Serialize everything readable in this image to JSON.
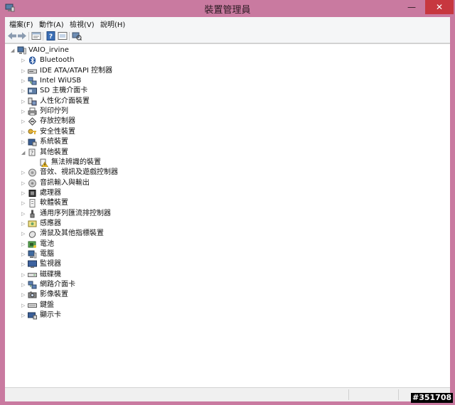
{
  "window": {
    "title": "裝置管理員",
    "minimize": "—",
    "maximize": "□",
    "close": "✕"
  },
  "menubar": {
    "items": [
      "檔案(F)",
      "動作(A)",
      "檢視(V)",
      "說明(H)"
    ]
  },
  "toolbar": {
    "buttons": [
      "back-icon",
      "forward-icon",
      "properties-icon",
      "help-icon",
      "update-view-icon",
      "scan-hardware-icon"
    ]
  },
  "tree": {
    "root": "VAIO_irvine",
    "categories": [
      {
        "label": "Bluetooth",
        "icon": "bluetooth-icon",
        "expanded": false
      },
      {
        "label": "IDE ATA/ATAPI 控制器",
        "icon": "ide-controller-icon",
        "expanded": false
      },
      {
        "label": "Intel WiUSB",
        "icon": "network-icon",
        "expanded": false
      },
      {
        "label": "SD 主機介面卡",
        "icon": "sd-host-icon",
        "expanded": false
      },
      {
        "label": "人性化介面裝置",
        "icon": "hid-icon",
        "expanded": false
      },
      {
        "label": "列印佇列",
        "icon": "printer-icon",
        "expanded": false
      },
      {
        "label": "存放控制器",
        "icon": "storage-controller-icon",
        "expanded": false
      },
      {
        "label": "安全性裝置",
        "icon": "security-device-icon",
        "expanded": false
      },
      {
        "label": "系統裝置",
        "icon": "system-device-icon",
        "expanded": false
      },
      {
        "label": "其他裝置",
        "icon": "other-devices-icon",
        "expanded": true,
        "children": [
          {
            "label": "無法辨識的裝置",
            "icon": "unknown-device-warning-icon"
          }
        ]
      },
      {
        "label": "音效、視訊及遊戲控制器",
        "icon": "sound-icon",
        "expanded": false
      },
      {
        "label": "音訊輸入與輸出",
        "icon": "audio-io-icon",
        "expanded": false
      },
      {
        "label": "處理器",
        "icon": "processor-icon",
        "expanded": false
      },
      {
        "label": "軟體裝置",
        "icon": "software-device-icon",
        "expanded": false
      },
      {
        "label": "通用序列匯流排控制器",
        "icon": "usb-icon",
        "expanded": false
      },
      {
        "label": "感應器",
        "icon": "sensor-icon",
        "expanded": false
      },
      {
        "label": "滑鼠及其他指標裝置",
        "icon": "mouse-icon",
        "expanded": false
      },
      {
        "label": "電池",
        "icon": "battery-icon",
        "expanded": false
      },
      {
        "label": "電腦",
        "icon": "computer-icon",
        "expanded": false
      },
      {
        "label": "監視器",
        "icon": "monitor-icon",
        "expanded": false
      },
      {
        "label": "磁碟機",
        "icon": "disk-drive-icon",
        "expanded": false
      },
      {
        "label": "網路介面卡",
        "icon": "network-adapter-icon",
        "expanded": false
      },
      {
        "label": "影像裝置",
        "icon": "imaging-device-icon",
        "expanded": false
      },
      {
        "label": "鍵盤",
        "icon": "keyboard-icon",
        "expanded": false
      },
      {
        "label": "顯示卡",
        "icon": "display-adapter-icon",
        "expanded": false
      }
    ]
  },
  "watermark": "#351708",
  "colors": {
    "frame": "#c97aa0",
    "close": "#c7373f"
  }
}
